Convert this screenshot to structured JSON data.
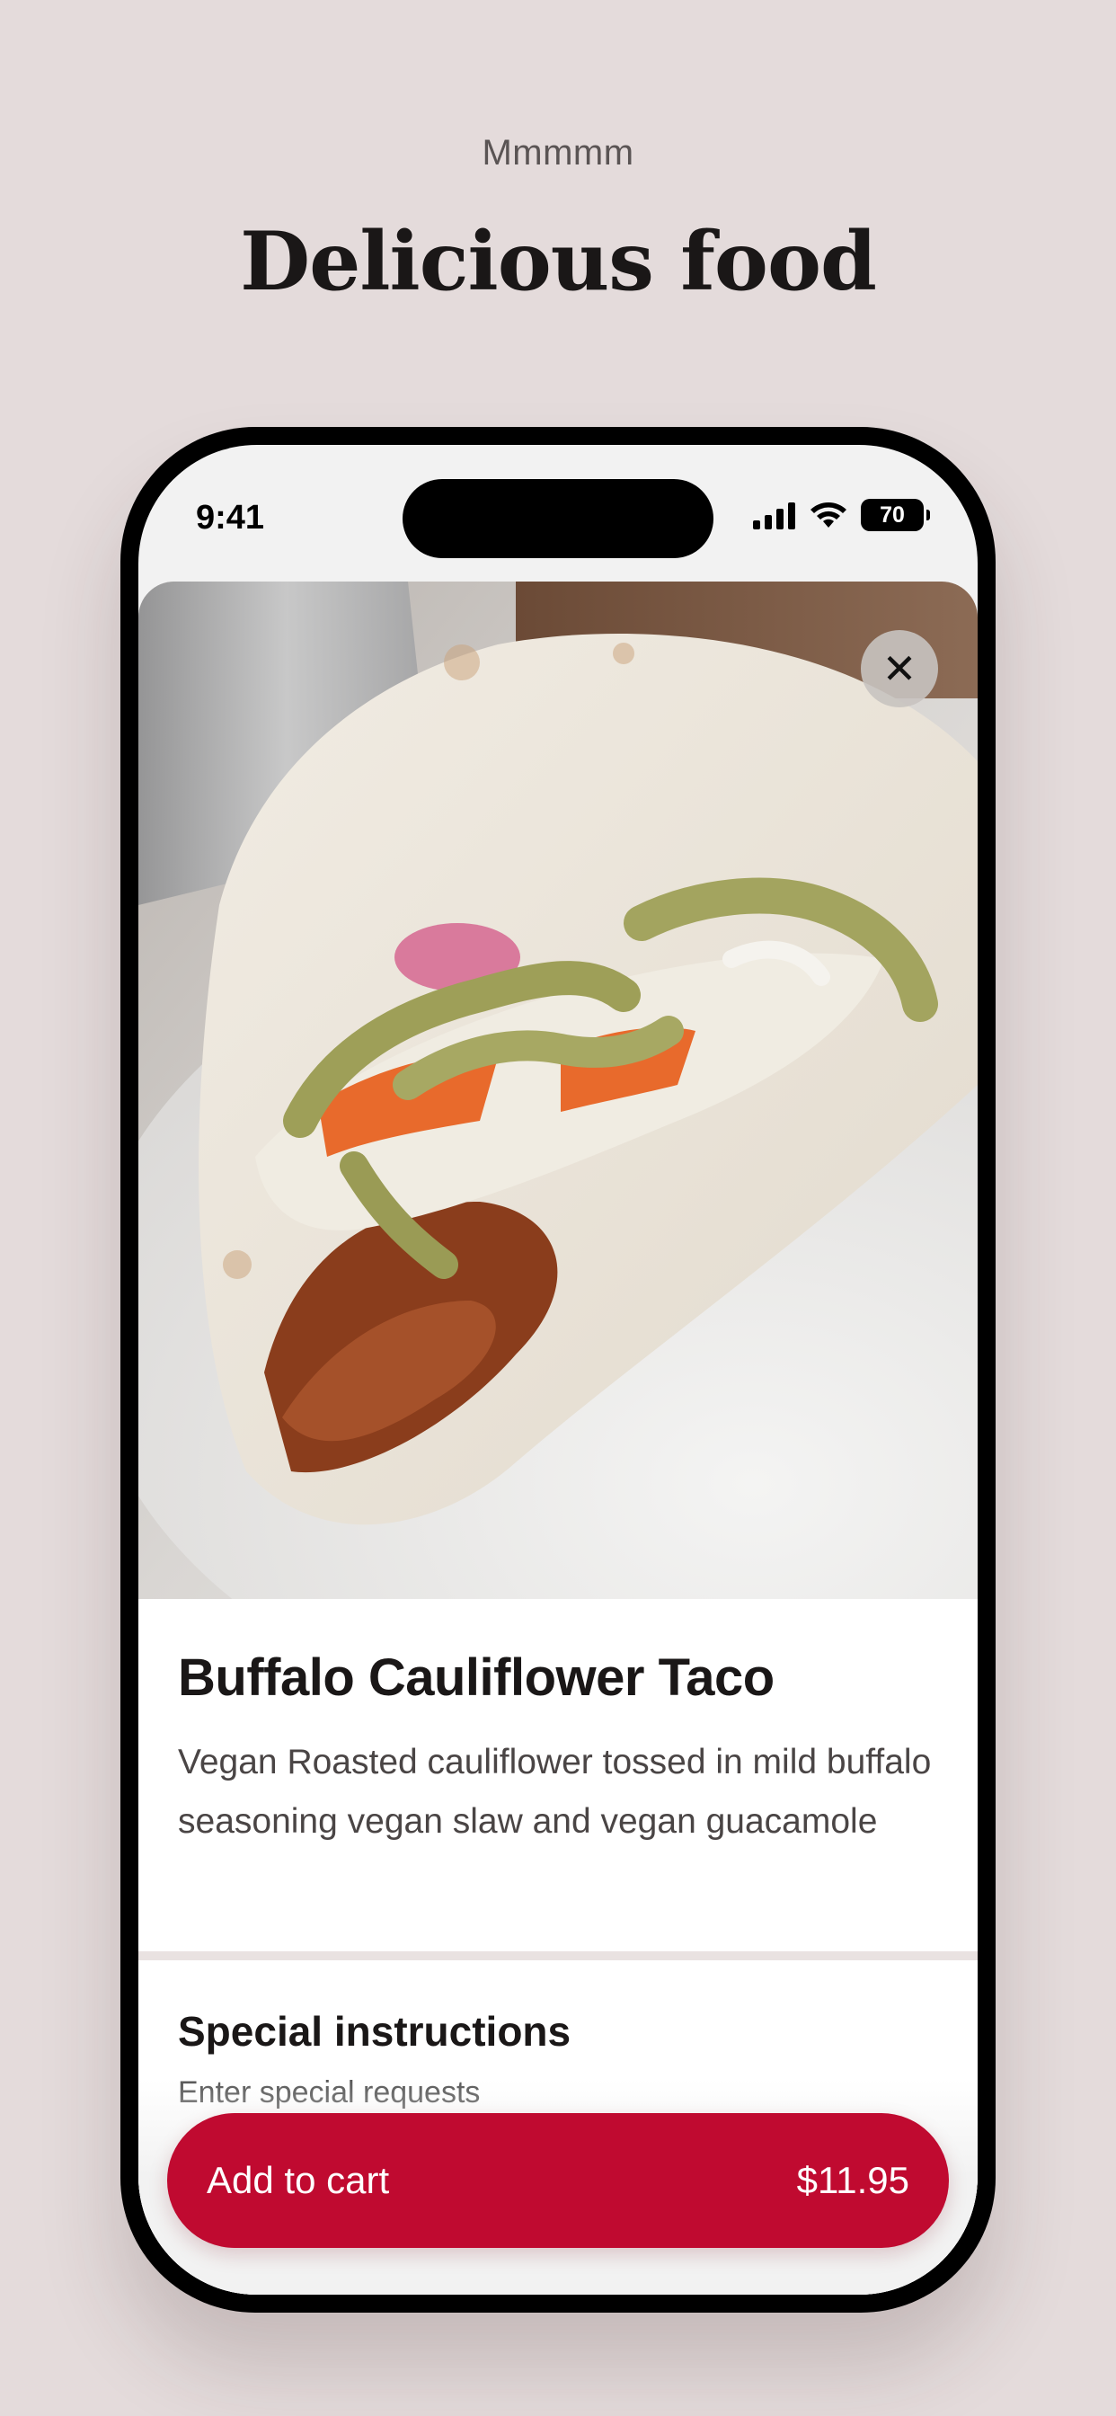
{
  "promo": {
    "eyebrow": "Mmmmm",
    "headline": "Delicious food"
  },
  "status_bar": {
    "time": "9:41",
    "battery": "70",
    "icons": [
      "signal-icon",
      "wifi-icon",
      "battery-icon"
    ]
  },
  "item": {
    "image_icon": "food-photo-taco",
    "close_icon": "close-icon",
    "title": "Buffalo Cauliflower Taco",
    "description": "Vegan Roasted cauliflower tossed in mild buffalo seasoning vegan slaw and vegan guacamole"
  },
  "instructions": {
    "title": "Special instructions",
    "placeholder": "Enter special requests"
  },
  "cart_button": {
    "label": "Add to cart",
    "price": "$11.95"
  },
  "colors": {
    "background": "#e4dbdb",
    "accent": "#c00a30",
    "text": "#1a1717"
  }
}
